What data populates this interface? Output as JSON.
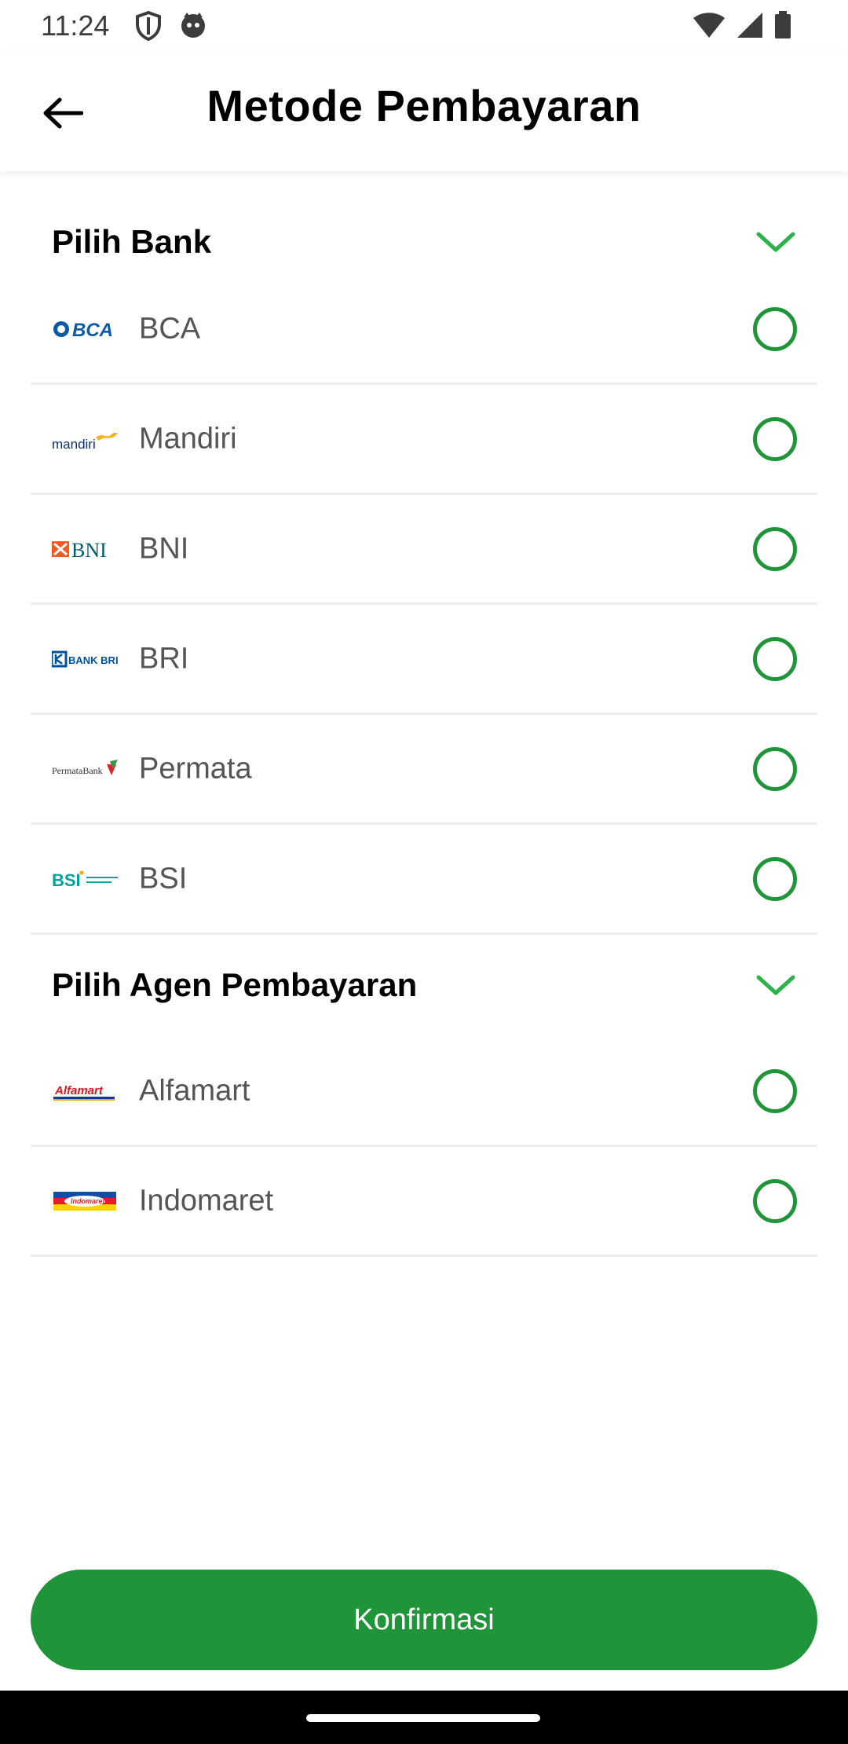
{
  "status_bar": {
    "time": "11:24",
    "icons_left": [
      "shield-icon",
      "cat-face-icon"
    ],
    "icons_right": [
      "wifi-icon",
      "signal-icon",
      "battery-icon"
    ]
  },
  "header": {
    "title": "Metode Pembayaran",
    "back_icon": "arrow-left-icon"
  },
  "sections": {
    "bank": {
      "title": "Pilih Bank",
      "expanded": true,
      "items": [
        {
          "label": "BCA",
          "logo": "BCA",
          "selected": false
        },
        {
          "label": "Mandiri",
          "logo": "mandiri",
          "selected": false
        },
        {
          "label": "BNI",
          "logo": "BNI",
          "selected": false
        },
        {
          "label": "BRI",
          "logo": "BANK BRI",
          "selected": false
        },
        {
          "label": "Permata",
          "logo": "PermataBank",
          "selected": false
        },
        {
          "label": "BSI",
          "logo": "BSI",
          "selected": false
        }
      ]
    },
    "agent": {
      "title": "Pilih Agen Pembayaran",
      "expanded": true,
      "items": [
        {
          "label": "Alfamart",
          "logo": "Alfamart",
          "selected": false
        },
        {
          "label": "Indomaret",
          "logo": "Indomaret",
          "selected": false
        }
      ]
    }
  },
  "confirm_button": {
    "label": "Konfirmasi"
  },
  "colors": {
    "accent": "#1f9438",
    "chevron": "#2bb34a",
    "divider": "#ececec",
    "label": "#555555"
  }
}
